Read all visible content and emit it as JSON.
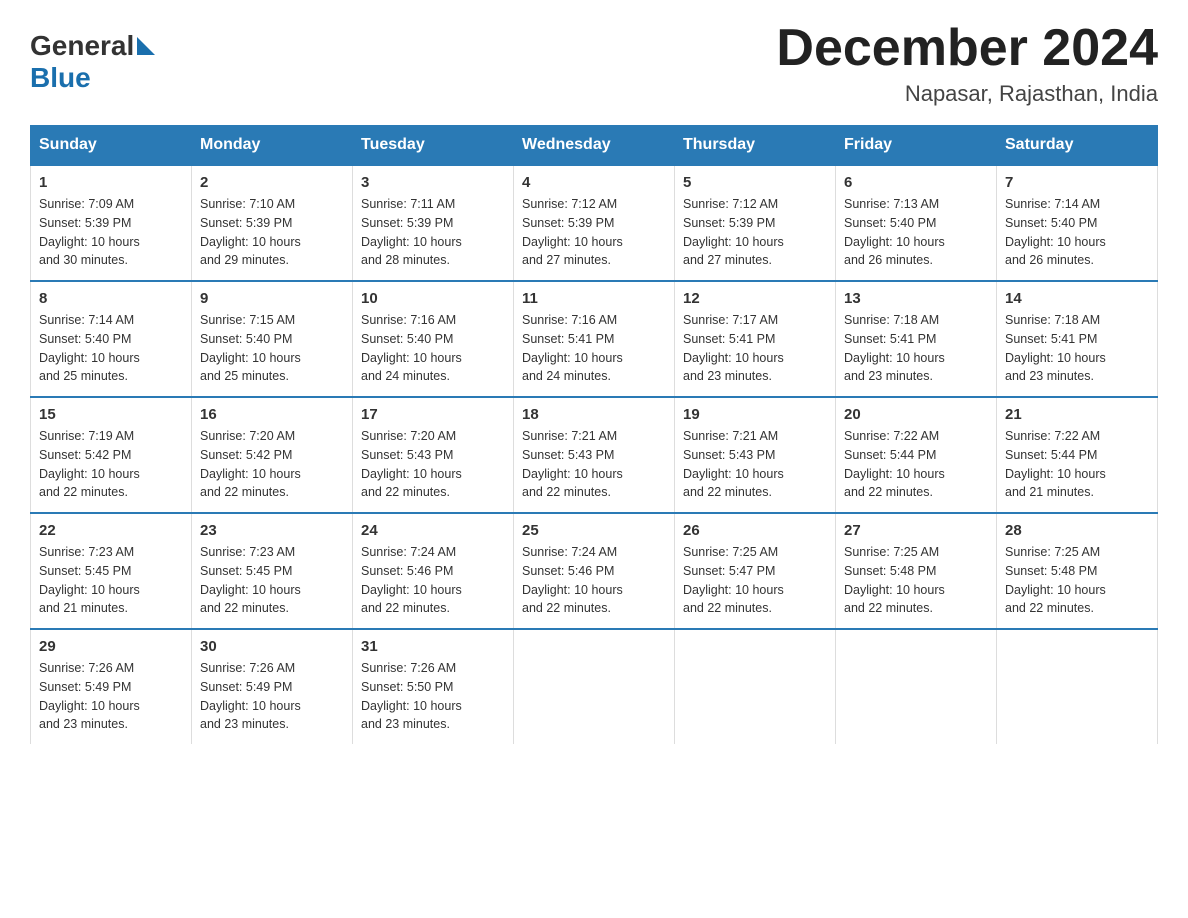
{
  "logo": {
    "text_general": "General",
    "text_blue": "Blue"
  },
  "title": "December 2024",
  "location": "Napasar, Rajasthan, India",
  "days_of_week": [
    "Sunday",
    "Monday",
    "Tuesday",
    "Wednesday",
    "Thursday",
    "Friday",
    "Saturday"
  ],
  "weeks": [
    [
      {
        "day": "1",
        "sunrise": "7:09 AM",
        "sunset": "5:39 PM",
        "daylight": "10 hours and 30 minutes."
      },
      {
        "day": "2",
        "sunrise": "7:10 AM",
        "sunset": "5:39 PM",
        "daylight": "10 hours and 29 minutes."
      },
      {
        "day": "3",
        "sunrise": "7:11 AM",
        "sunset": "5:39 PM",
        "daylight": "10 hours and 28 minutes."
      },
      {
        "day": "4",
        "sunrise": "7:12 AM",
        "sunset": "5:39 PM",
        "daylight": "10 hours and 27 minutes."
      },
      {
        "day": "5",
        "sunrise": "7:12 AM",
        "sunset": "5:39 PM",
        "daylight": "10 hours and 27 minutes."
      },
      {
        "day": "6",
        "sunrise": "7:13 AM",
        "sunset": "5:40 PM",
        "daylight": "10 hours and 26 minutes."
      },
      {
        "day": "7",
        "sunrise": "7:14 AM",
        "sunset": "5:40 PM",
        "daylight": "10 hours and 26 minutes."
      }
    ],
    [
      {
        "day": "8",
        "sunrise": "7:14 AM",
        "sunset": "5:40 PM",
        "daylight": "10 hours and 25 minutes."
      },
      {
        "day": "9",
        "sunrise": "7:15 AM",
        "sunset": "5:40 PM",
        "daylight": "10 hours and 25 minutes."
      },
      {
        "day": "10",
        "sunrise": "7:16 AM",
        "sunset": "5:40 PM",
        "daylight": "10 hours and 24 minutes."
      },
      {
        "day": "11",
        "sunrise": "7:16 AM",
        "sunset": "5:41 PM",
        "daylight": "10 hours and 24 minutes."
      },
      {
        "day": "12",
        "sunrise": "7:17 AM",
        "sunset": "5:41 PM",
        "daylight": "10 hours and 23 minutes."
      },
      {
        "day": "13",
        "sunrise": "7:18 AM",
        "sunset": "5:41 PM",
        "daylight": "10 hours and 23 minutes."
      },
      {
        "day": "14",
        "sunrise": "7:18 AM",
        "sunset": "5:41 PM",
        "daylight": "10 hours and 23 minutes."
      }
    ],
    [
      {
        "day": "15",
        "sunrise": "7:19 AM",
        "sunset": "5:42 PM",
        "daylight": "10 hours and 22 minutes."
      },
      {
        "day": "16",
        "sunrise": "7:20 AM",
        "sunset": "5:42 PM",
        "daylight": "10 hours and 22 minutes."
      },
      {
        "day": "17",
        "sunrise": "7:20 AM",
        "sunset": "5:43 PM",
        "daylight": "10 hours and 22 minutes."
      },
      {
        "day": "18",
        "sunrise": "7:21 AM",
        "sunset": "5:43 PM",
        "daylight": "10 hours and 22 minutes."
      },
      {
        "day": "19",
        "sunrise": "7:21 AM",
        "sunset": "5:43 PM",
        "daylight": "10 hours and 22 minutes."
      },
      {
        "day": "20",
        "sunrise": "7:22 AM",
        "sunset": "5:44 PM",
        "daylight": "10 hours and 22 minutes."
      },
      {
        "day": "21",
        "sunrise": "7:22 AM",
        "sunset": "5:44 PM",
        "daylight": "10 hours and 21 minutes."
      }
    ],
    [
      {
        "day": "22",
        "sunrise": "7:23 AM",
        "sunset": "5:45 PM",
        "daylight": "10 hours and 21 minutes."
      },
      {
        "day": "23",
        "sunrise": "7:23 AM",
        "sunset": "5:45 PM",
        "daylight": "10 hours and 22 minutes."
      },
      {
        "day": "24",
        "sunrise": "7:24 AM",
        "sunset": "5:46 PM",
        "daylight": "10 hours and 22 minutes."
      },
      {
        "day": "25",
        "sunrise": "7:24 AM",
        "sunset": "5:46 PM",
        "daylight": "10 hours and 22 minutes."
      },
      {
        "day": "26",
        "sunrise": "7:25 AM",
        "sunset": "5:47 PM",
        "daylight": "10 hours and 22 minutes."
      },
      {
        "day": "27",
        "sunrise": "7:25 AM",
        "sunset": "5:48 PM",
        "daylight": "10 hours and 22 minutes."
      },
      {
        "day": "28",
        "sunrise": "7:25 AM",
        "sunset": "5:48 PM",
        "daylight": "10 hours and 22 minutes."
      }
    ],
    [
      {
        "day": "29",
        "sunrise": "7:26 AM",
        "sunset": "5:49 PM",
        "daylight": "10 hours and 23 minutes."
      },
      {
        "day": "30",
        "sunrise": "7:26 AM",
        "sunset": "5:49 PM",
        "daylight": "10 hours and 23 minutes."
      },
      {
        "day": "31",
        "sunrise": "7:26 AM",
        "sunset": "5:50 PM",
        "daylight": "10 hours and 23 minutes."
      },
      null,
      null,
      null,
      null
    ]
  ],
  "sunrise_label": "Sunrise: ",
  "sunset_label": "Sunset: ",
  "daylight_label": "Daylight: "
}
